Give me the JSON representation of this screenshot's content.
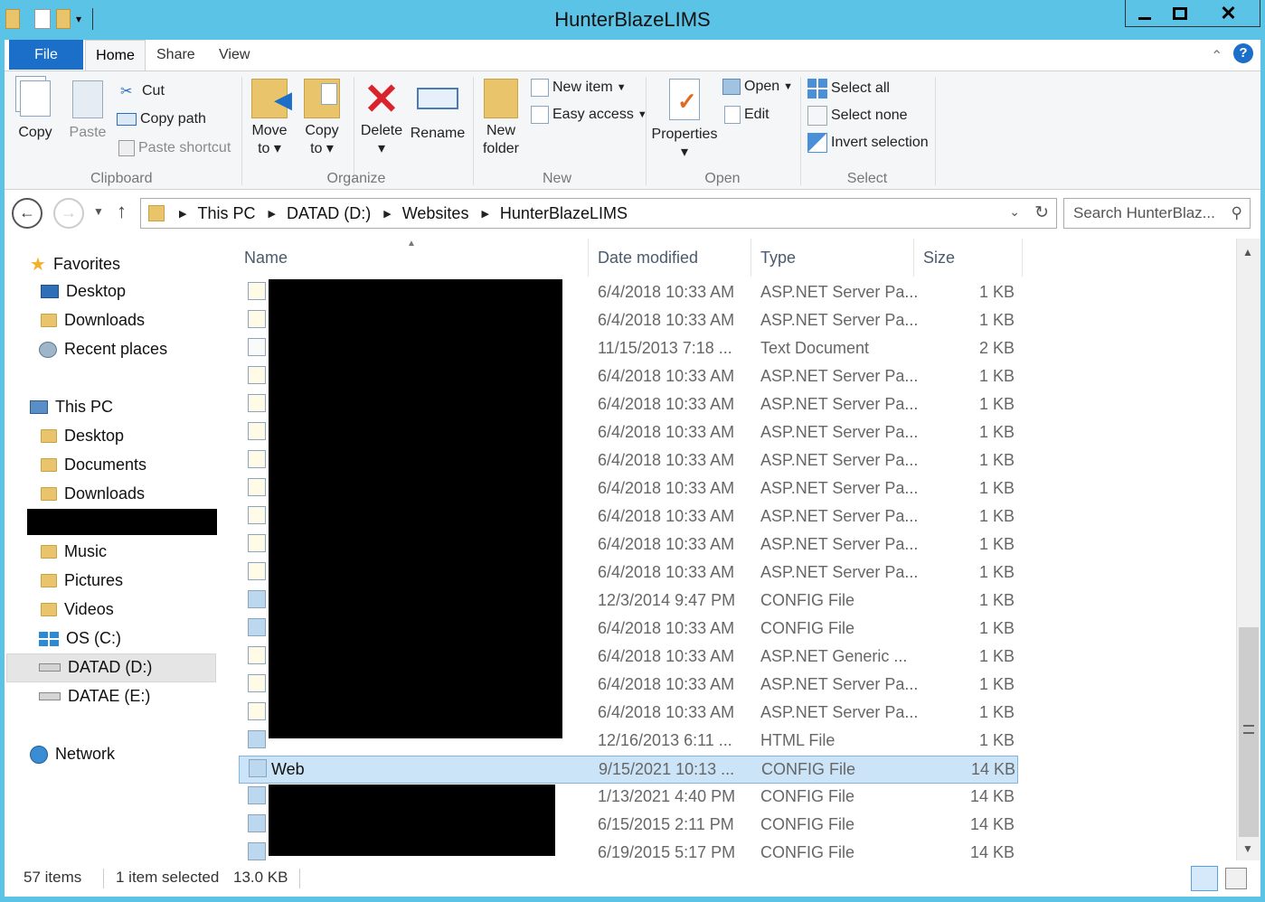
{
  "window": {
    "title": "HunterBlazeLIMS",
    "minimize": "▁",
    "maximize": "☐",
    "close": "✕"
  },
  "menu": {
    "file": "File",
    "home": "Home",
    "share": "Share",
    "view": "View"
  },
  "ribbon": {
    "clipboard": {
      "copy": "Copy",
      "paste": "Paste",
      "cut": "Cut",
      "copy_path": "Copy path",
      "paste_shortcut": "Paste shortcut",
      "label": "Clipboard"
    },
    "organize": {
      "move_to": "Move",
      "move_to2": "to",
      "copy_to": "Copy",
      "copy_to2": "to",
      "delete": "Delete",
      "rename": "Rename",
      "label": "Organize"
    },
    "new": {
      "new_folder": "New",
      "new_folder2": "folder",
      "new_item": "New item",
      "easy_access": "Easy access",
      "label": "New"
    },
    "open": {
      "properties": "Properties",
      "open": "Open",
      "edit": "Edit",
      "label": "Open"
    },
    "select": {
      "select_all": "Select all",
      "select_none": "Select none",
      "invert": "Invert selection",
      "label": "Select"
    }
  },
  "address": {
    "crumbs": [
      "This PC",
      "DATAD (D:)",
      "Websites",
      "HunterBlazeLIMS"
    ],
    "search_placeholder": "Search HunterBlaz..."
  },
  "nav": {
    "favorites": "Favorites",
    "desktop": "Desktop",
    "downloads": "Downloads",
    "recent": "Recent places",
    "this_pc": "This PC",
    "pc_desktop": "Desktop",
    "documents": "Documents",
    "pc_downloads": "Downloads",
    "music": "Music",
    "pictures": "Pictures",
    "videos": "Videos",
    "os_c": "OS (C:)",
    "datad": "DATAD (D:)",
    "datae": "DATAE (E:)",
    "network": "Network"
  },
  "columns": {
    "name": "Name",
    "date": "Date modified",
    "type": "Type",
    "size": "Size"
  },
  "files": [
    {
      "name": "",
      "date": "6/4/2018 10:33 AM",
      "type": "ASP.NET Server Pa...",
      "size": "1 KB",
      "icon": "aspx"
    },
    {
      "name": "",
      "date": "6/4/2018 10:33 AM",
      "type": "ASP.NET Server Pa...",
      "size": "1 KB",
      "icon": "aspx"
    },
    {
      "name": "",
      "date": "11/15/2013 7:18 ...",
      "type": "Text Document",
      "size": "2 KB",
      "icon": "txt"
    },
    {
      "name": "",
      "date": "6/4/2018 10:33 AM",
      "type": "ASP.NET Server Pa...",
      "size": "1 KB",
      "icon": "aspx"
    },
    {
      "name": "",
      "date": "6/4/2018 10:33 AM",
      "type": "ASP.NET Server Pa...",
      "size": "1 KB",
      "icon": "aspx"
    },
    {
      "name": "",
      "date": "6/4/2018 10:33 AM",
      "type": "ASP.NET Server Pa...",
      "size": "1 KB",
      "icon": "aspx"
    },
    {
      "name": "",
      "date": "6/4/2018 10:33 AM",
      "type": "ASP.NET Server Pa...",
      "size": "1 KB",
      "icon": "aspx"
    },
    {
      "name": "",
      "date": "6/4/2018 10:33 AM",
      "type": "ASP.NET Server Pa...",
      "size": "1 KB",
      "icon": "aspx"
    },
    {
      "name": "",
      "date": "6/4/2018 10:33 AM",
      "type": "ASP.NET Server Pa...",
      "size": "1 KB",
      "icon": "aspx"
    },
    {
      "name": "",
      "date": "6/4/2018 10:33 AM",
      "type": "ASP.NET Server Pa...",
      "size": "1 KB",
      "icon": "aspx"
    },
    {
      "name": "",
      "date": "6/4/2018 10:33 AM",
      "type": "ASP.NET Server Pa...",
      "size": "1 KB",
      "icon": "aspx"
    },
    {
      "name": "",
      "date": "12/3/2014 9:47 PM",
      "type": "CONFIG File",
      "size": "1 KB",
      "icon": "config"
    },
    {
      "name": "",
      "date": "6/4/2018 10:33 AM",
      "type": "CONFIG File",
      "size": "1 KB",
      "icon": "config"
    },
    {
      "name": "",
      "date": "6/4/2018 10:33 AM",
      "type": "ASP.NET Generic ...",
      "size": "1 KB",
      "icon": "ashx"
    },
    {
      "name": "",
      "date": "6/4/2018 10:33 AM",
      "type": "ASP.NET Server Pa...",
      "size": "1 KB",
      "icon": "aspx"
    },
    {
      "name": "",
      "date": "6/4/2018 10:33 AM",
      "type": "ASP.NET Server Pa...",
      "size": "1 KB",
      "icon": "aspx"
    },
    {
      "name": "",
      "date": "12/16/2013 6:11 ...",
      "type": "HTML File",
      "size": "1 KB",
      "icon": "config"
    },
    {
      "name": "Web",
      "date": "9/15/2021 10:13 ...",
      "type": "CONFIG File",
      "size": "14 KB",
      "icon": "config",
      "selected": true
    },
    {
      "name": "",
      "date": "1/13/2021 4:40 PM",
      "type": "CONFIG File",
      "size": "14 KB",
      "icon": "config"
    },
    {
      "name": "",
      "date": "6/15/2015 2:11 PM",
      "type": "CONFIG File",
      "size": "14 KB",
      "icon": "config"
    },
    {
      "name": "",
      "date": "6/19/2015 5:17 PM",
      "type": "CONFIG File",
      "size": "14 KB",
      "icon": "config"
    }
  ],
  "status": {
    "items": "57 items",
    "selected": "1 item selected",
    "size": "13.0 KB"
  },
  "colors": {
    "titlebar": "#5bc3e6",
    "file_tab": "#1c6fc9",
    "selection": "#cce4f7"
  }
}
